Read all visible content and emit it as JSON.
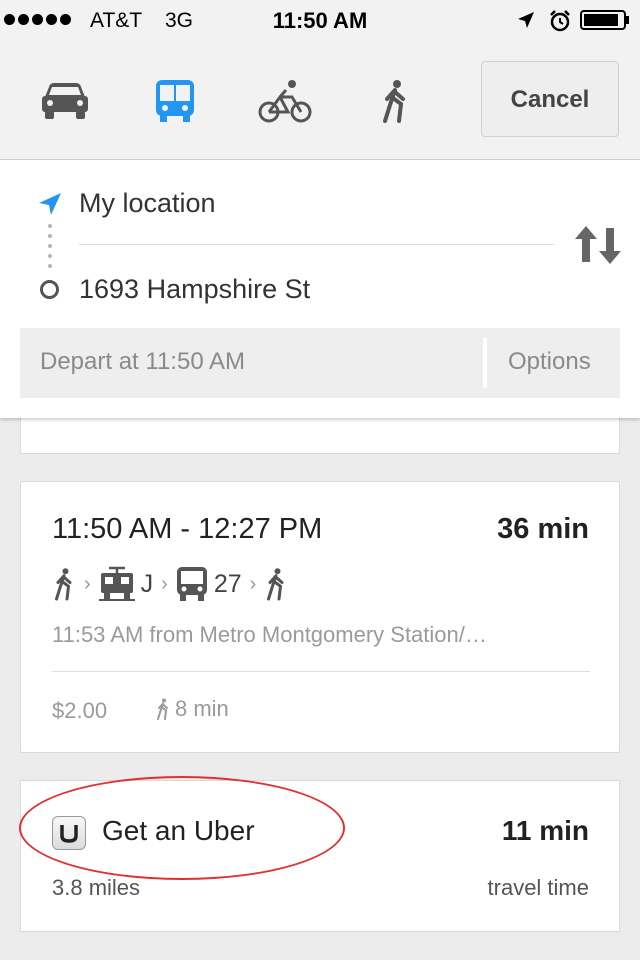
{
  "status_bar": {
    "carrier": "AT&T",
    "network": "3G",
    "time": "11:50 AM"
  },
  "modes": {
    "items": [
      {
        "icon": "car-icon",
        "selected": false
      },
      {
        "icon": "transit-icon",
        "selected": true
      },
      {
        "icon": "bicycle-icon",
        "selected": false
      },
      {
        "icon": "walk-icon",
        "selected": false
      }
    ],
    "cancel_label": "Cancel"
  },
  "directions": {
    "from": "My location",
    "to": "1693 Hampshire St",
    "depart_label": "Depart at 11:50 AM",
    "options_label": "Options"
  },
  "route": {
    "times": "11:50 AM - 12:27 PM",
    "duration": "36 min",
    "steps": [
      {
        "icon": "walk-icon"
      },
      {
        "icon": "tram-icon",
        "label": "J"
      },
      {
        "icon": "bus-icon",
        "label": "27"
      },
      {
        "icon": "walk-icon"
      }
    ],
    "detail": "11:53 AM from Metro Montgomery Station/…",
    "fare": "$2.00",
    "walk_time": "8 min"
  },
  "uber": {
    "label": "Get an Uber",
    "time": "11 min",
    "distance": "3.8 miles",
    "time_caption": "travel time"
  },
  "colors": {
    "accent_blue": "#2196F3",
    "highlight_red": "#E0312F",
    "icon_gray": "#555555"
  }
}
